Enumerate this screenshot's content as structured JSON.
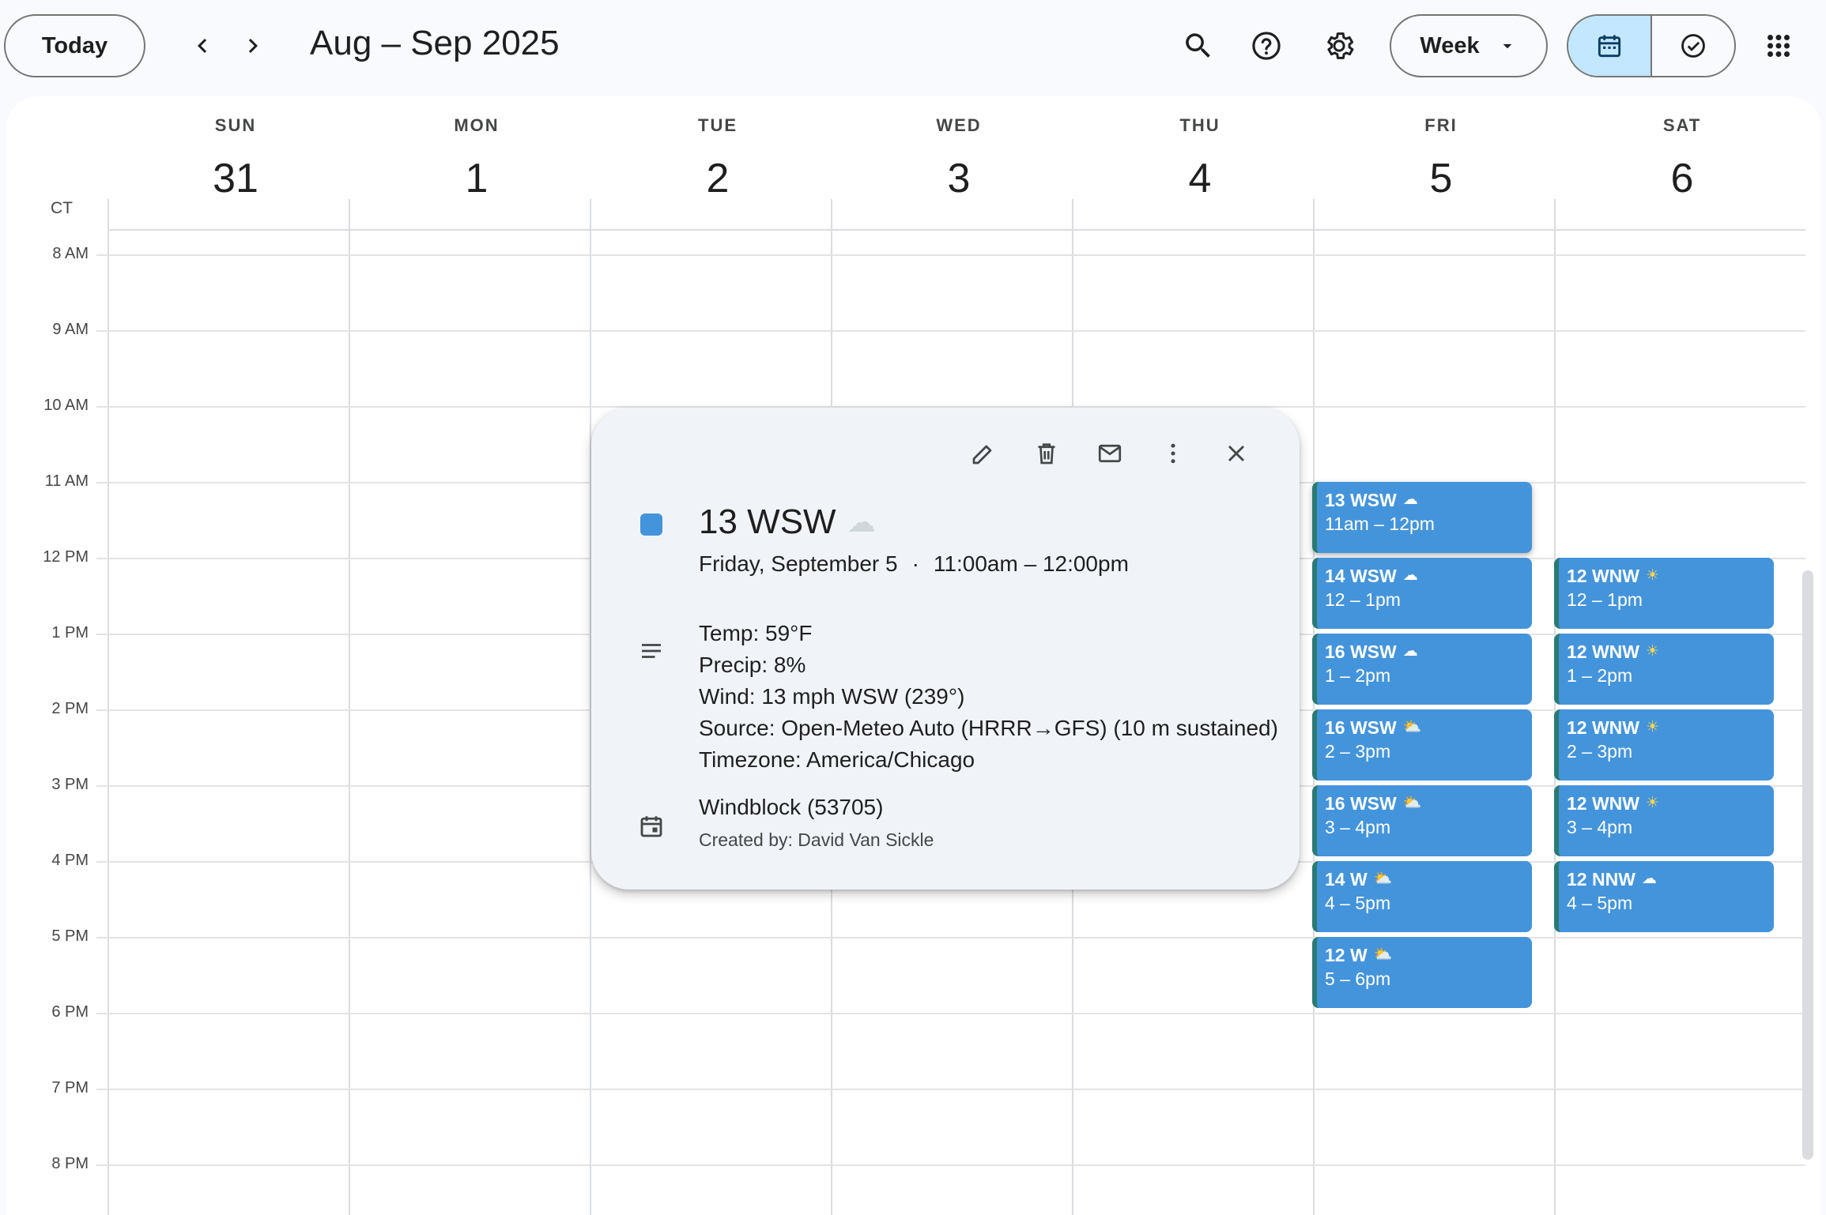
{
  "header": {
    "today_label": "Today",
    "date_range": "Aug – Sep 2025",
    "view_label": "Week",
    "icons": [
      "chevron-left-icon",
      "chevron-right-icon",
      "search-icon",
      "help-icon",
      "gear-icon",
      "dropdown-arrow-icon",
      "calendar-icon",
      "tasks-check-icon",
      "apps-grid-icon"
    ]
  },
  "timezone_label": "CT",
  "days": [
    {
      "dow": "SUN",
      "num": "31"
    },
    {
      "dow": "MON",
      "num": "1"
    },
    {
      "dow": "TUE",
      "num": "2"
    },
    {
      "dow": "WED",
      "num": "3"
    },
    {
      "dow": "THU",
      "num": "4"
    },
    {
      "dow": "FRI",
      "num": "5"
    },
    {
      "dow": "SAT",
      "num": "6"
    }
  ],
  "hours": [
    "8 AM",
    "9 AM",
    "10 AM",
    "11 AM",
    "12 PM",
    "1 PM",
    "2 PM",
    "3 PM",
    "4 PM",
    "5 PM",
    "6 PM",
    "7 PM",
    "8 PM"
  ],
  "events": {
    "fri": [
      {
        "title": "13 WSW",
        "icon": "☁",
        "time": "11am – 12pm"
      },
      {
        "title": "14 WSW",
        "icon": "☁",
        "time": "12 – 1pm"
      },
      {
        "title": "16 WSW",
        "icon": "☁",
        "time": "1 – 2pm"
      },
      {
        "title": "16 WSW",
        "icon": "⛅",
        "time": "2 – 3pm"
      },
      {
        "title": "16 WSW",
        "icon": "⛅",
        "time": "3 – 4pm"
      },
      {
        "title": "14 W",
        "icon": "⛅",
        "time": "4 – 5pm"
      },
      {
        "title": "12 W",
        "icon": "⛅",
        "time": "5 – 6pm"
      }
    ],
    "sat": [
      {
        "title": "12 WNW",
        "icon": "☀",
        "time": "12 – 1pm"
      },
      {
        "title": "12 WNW",
        "icon": "☀",
        "time": "1 – 2pm"
      },
      {
        "title": "12 WNW",
        "icon": "☀",
        "time": "2 – 3pm"
      },
      {
        "title": "12 WNW",
        "icon": "☀",
        "time": "3 – 4pm"
      },
      {
        "title": "12 NNW",
        "icon": "☁",
        "time": "4 – 5pm"
      }
    ]
  },
  "popup": {
    "title": "13 WSW",
    "title_icon": "☁",
    "date": "Friday, September 5",
    "separator": "·",
    "time": "11:00am – 12:00pm",
    "description": [
      "Temp: 59°F",
      "Precip: 8%",
      "Wind: 13 mph WSW (239°)",
      "Source: Open-Meteo Auto (HRRR→GFS) (10 m sustained)",
      "Timezone: America/Chicago"
    ],
    "calendar_name": "Windblock (53705)",
    "creator": "Created by: David Van Sickle",
    "icons": [
      "edit-pencil-icon",
      "delete-trash-icon",
      "email-icon",
      "more-vert-icon",
      "close-icon",
      "description-lines-icon",
      "calendar-event-icon"
    ]
  },
  "colors": {
    "event_bg": "#4494db",
    "event_border": "#2a7a74",
    "active_view_bg": "#c2e7ff",
    "page_bg": "#f8fafd",
    "popup_bg": "#f0f4f9"
  }
}
